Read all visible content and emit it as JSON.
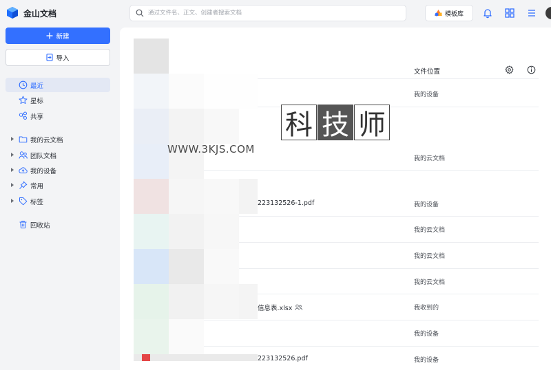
{
  "app": {
    "name": "金山文档",
    "brand_color": "#3370ff"
  },
  "search": {
    "placeholder": "通过文件名、正文、创建者搜索文档",
    "value": ""
  },
  "topbar": {
    "template_label": "模板库",
    "icons": [
      "bell-icon",
      "grid-icon",
      "menu-icon"
    ]
  },
  "sidebar": {
    "new_label": "新建",
    "import_label": "导入",
    "items": [
      {
        "label": "最近",
        "icon": "clock-icon",
        "active": true
      },
      {
        "label": "星标",
        "icon": "star-icon"
      },
      {
        "label": "共享",
        "icon": "share-icon"
      },
      {
        "label": "我的云文档",
        "icon": "folder-icon",
        "expandable": true
      },
      {
        "label": "团队文档",
        "icon": "team-icon",
        "expandable": true
      },
      {
        "label": "我的设备",
        "icon": "cloud-upload-icon",
        "expandable": true
      },
      {
        "label": "常用",
        "icon": "pin-icon",
        "expandable": true
      },
      {
        "label": "标签",
        "icon": "tag-icon",
        "expandable": true
      },
      {
        "label": "回收站",
        "icon": "trash-icon"
      }
    ]
  },
  "table": {
    "location_header": "文件位置",
    "rows": [
      {
        "name": "",
        "location": "我的设备"
      },
      {
        "name": "",
        "location": "我的云文档"
      },
      {
        "name": "223132526-1.pdf",
        "location": "我的设备"
      },
      {
        "name": "",
        "location": "我的云文档"
      },
      {
        "name": "",
        "location": "我的云文档"
      },
      {
        "name": "",
        "location": "我的云文档"
      },
      {
        "name": "信息表.xlsx",
        "location": "我收到的",
        "shared": true
      },
      {
        "name": "",
        "location": "我的设备"
      },
      {
        "name": "223132526.pdf",
        "location": "我的设备"
      }
    ]
  },
  "watermark": {
    "chars": [
      "科",
      "技",
      "师"
    ],
    "url": "WWW.3KJS.COM"
  }
}
